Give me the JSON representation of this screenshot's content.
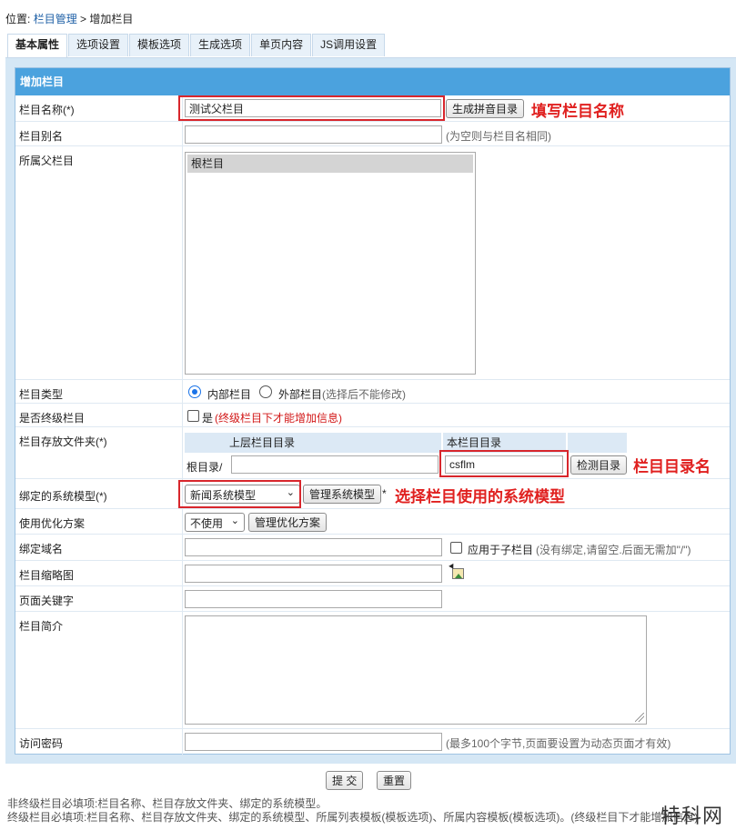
{
  "breadcrumb": {
    "prefix": "位置:",
    "link": "栏目管理",
    "separator": ">",
    "current": "增加栏目"
  },
  "tabs": [
    "基本属性",
    "选项设置",
    "模板选项",
    "生成选项",
    "单页内容",
    "JS调用设置"
  ],
  "form": {
    "header": "增加栏目",
    "name": {
      "label": "栏目名称(*)",
      "value": "测试父栏目",
      "button": "生成拼音目录",
      "annotation": "填写栏目名称"
    },
    "alias": {
      "label": "栏目别名",
      "value": "",
      "hint": "(为空则与栏目名相同)"
    },
    "parent": {
      "label": "所属父栏目",
      "options": [
        "根栏目"
      ]
    },
    "type": {
      "label": "栏目类型",
      "option1": "内部栏目",
      "option2": "外部栏目",
      "hint": "(选择后不能修改)"
    },
    "final": {
      "label": "是否终级栏目",
      "check_label": "是",
      "hint": "(终级栏目下才能增加信息)"
    },
    "folder": {
      "label": "栏目存放文件夹(*)",
      "col_parent": "上层栏目目录",
      "col_self": "本栏目目录",
      "root_label": "根目录/",
      "parent_value": "",
      "self_value": "csflm",
      "button": "检测目录",
      "annotation": "栏目目录名"
    },
    "model": {
      "label": "绑定的系统模型(*)",
      "selected": "新闻系统模型",
      "button": "管理系统模型",
      "star": "*",
      "annotation": "选择栏目使用的系统模型"
    },
    "optimize": {
      "label": "使用优化方案",
      "selected": "不使用",
      "button": "管理优化方案"
    },
    "domain": {
      "label": "绑定域名",
      "value": "",
      "check_label": "应用于子栏目",
      "hint": "(没有绑定,请留空.后面无需加\"/\")"
    },
    "thumb": {
      "label": "栏目缩略图",
      "value": ""
    },
    "keywords": {
      "label": "页面关键字",
      "value": ""
    },
    "intro": {
      "label": "栏目简介",
      "value": ""
    },
    "password": {
      "label": "访问密码",
      "value": "",
      "hint": "(最多100个字节,页面要设置为动态页面才有效)"
    }
  },
  "actions": {
    "submit": "提 交",
    "reset": "重置"
  },
  "notes": {
    "line1": "非终级栏目必填项:栏目名称、栏目存放文件夹、绑定的系统模型。",
    "line2": "终级栏目必填项:栏目名称、栏目存放文件夹、绑定的系统模型、所属列表模板(模板选项)、所属内容模板(模板选项)。(终级栏目下才能增加信息)"
  },
  "watermark": "特科网",
  "icons": {
    "select_arrow": "chevron-down-icon",
    "thumb": "image-picker-icon",
    "resize": "resize-grip-icon"
  }
}
